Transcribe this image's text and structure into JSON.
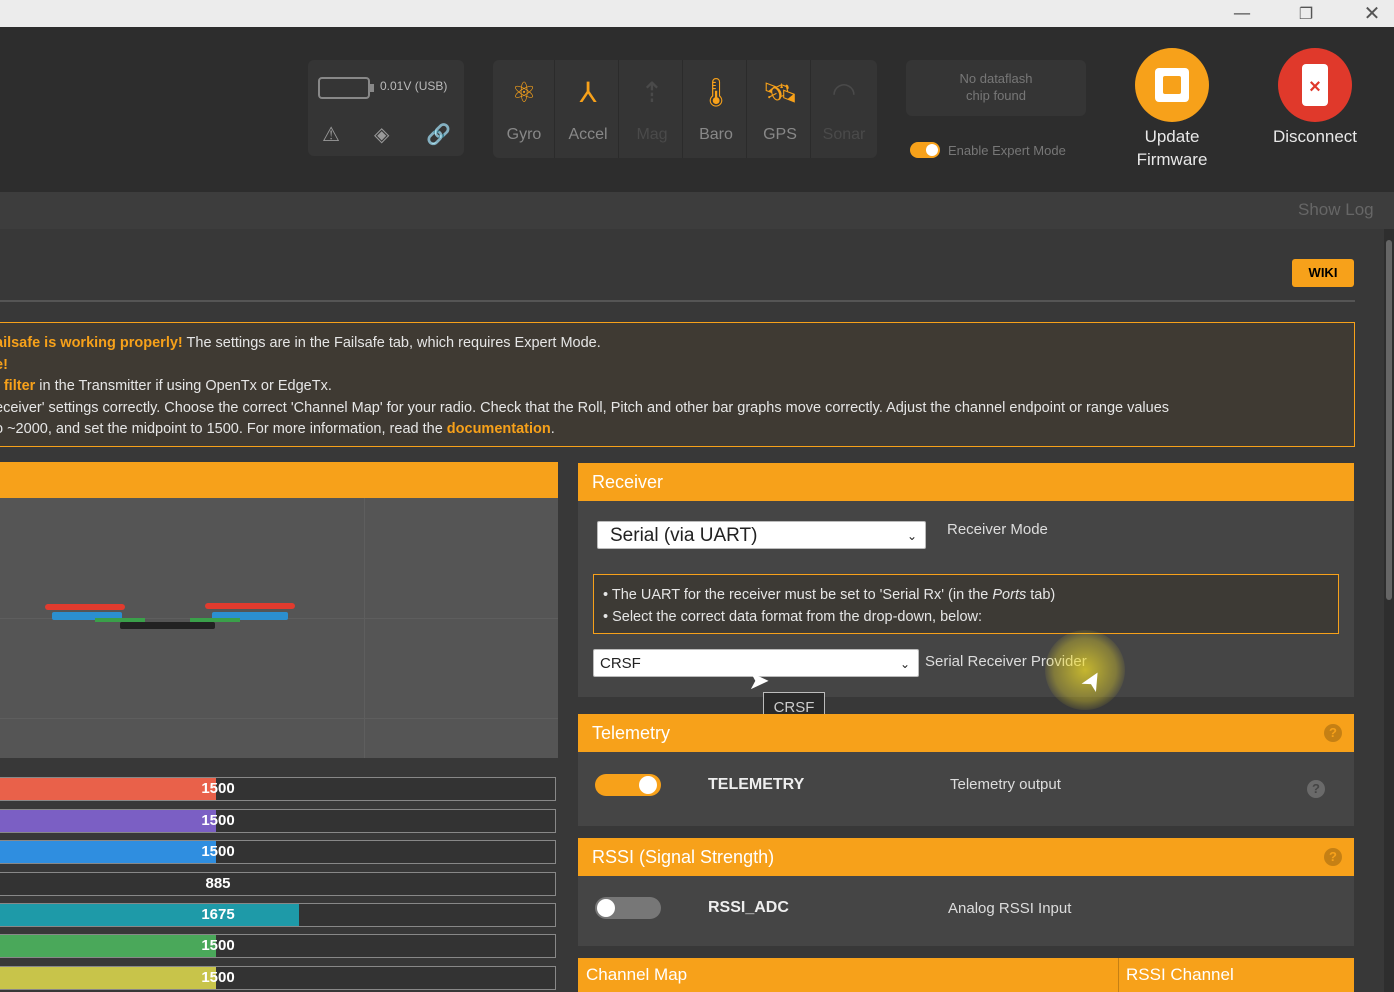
{
  "window": {
    "minimize": "—",
    "maximize": "❐",
    "close": "✕"
  },
  "header": {
    "voltage": "0.01V (USB)",
    "sensors": [
      {
        "name": "Gyro",
        "icon": "gyro-icon",
        "active": true
      },
      {
        "name": "Accel",
        "icon": "accel-icon",
        "active": true
      },
      {
        "name": "Mag",
        "icon": "mag-icon",
        "active": false
      },
      {
        "name": "Baro",
        "icon": "baro-icon",
        "active": true
      },
      {
        "name": "GPS",
        "icon": "gps-icon",
        "active": true
      },
      {
        "name": "Sonar",
        "icon": "sonar-icon",
        "active": false
      }
    ],
    "dataflash_line1": "No dataflash",
    "dataflash_line2": "chip found",
    "expert_mode_label": "Enable Expert Mode",
    "update_line1": "Update",
    "update_line2": "Firmware",
    "disconnect": "Disconnect"
  },
  "logbar": {
    "show_log": "Show Log"
  },
  "wiki": "WIKI",
  "note": {
    "line1_hl": "ailsafe is working properly!",
    "line1_rest": " The settings are in the Failsafe tab, which requires Expert Mode.",
    "line2": "e!",
    "line3_hl": ": filter",
    "line3_rest": " in the Transmitter if using OpenTx or EdgeTx.",
    "line4": "eceiver' settings correctly. Choose the correct 'Channel Map' for your radio. Check that the Roll, Pitch and other bar graphs move correctly. Adjust the channel endpoint or range values",
    "line5_a": "o ~2000, and set the midpoint to 1500. For more information, read the ",
    "line5_link": "documentation",
    "line5_b": "."
  },
  "channels": [
    {
      "value": "1500",
      "fill": 0.39,
      "color": "#e9614a"
    },
    {
      "value": "1500",
      "fill": 0.39,
      "color": "#7b5fc4"
    },
    {
      "value": "1500",
      "fill": 0.39,
      "color": "#2f8ee0"
    },
    {
      "value": "885",
      "fill": 0.0,
      "color": "#888888"
    },
    {
      "value": "1675",
      "fill": 0.54,
      "color": "#1e9aa8"
    },
    {
      "value": "1500",
      "fill": 0.39,
      "color": "#4aa85a"
    },
    {
      "value": "1500",
      "fill": 0.39,
      "color": "#c8c44a"
    }
  ],
  "receiver": {
    "title": "Receiver",
    "mode_value": "Serial (via UART)",
    "mode_label": "Receiver Mode",
    "uart_note_1a": "• The UART for the receiver must be set to 'Serial Rx' (in the ",
    "uart_note_1b": "Ports",
    "uart_note_1c": " tab)",
    "uart_note_2": "• Select the correct data format from the drop-down, below:",
    "provider_value": "CRSF",
    "provider_label": "Serial Receiver Provider",
    "tooltip": "CRSF"
  },
  "telemetry": {
    "title": "Telemetry",
    "feature": "TELEMETRY",
    "desc": "Telemetry output",
    "enabled": true
  },
  "rssi": {
    "title": "RSSI (Signal Strength)",
    "feature": "RSSI_ADC",
    "desc": "Analog RSSI Input",
    "enabled": false
  },
  "channel_map": {
    "left": "Channel Map",
    "right": "RSSI Channel"
  },
  "help_glyph": "?",
  "colors": {
    "accent": "#f7a11a",
    "disconnect": "#e0392b"
  }
}
